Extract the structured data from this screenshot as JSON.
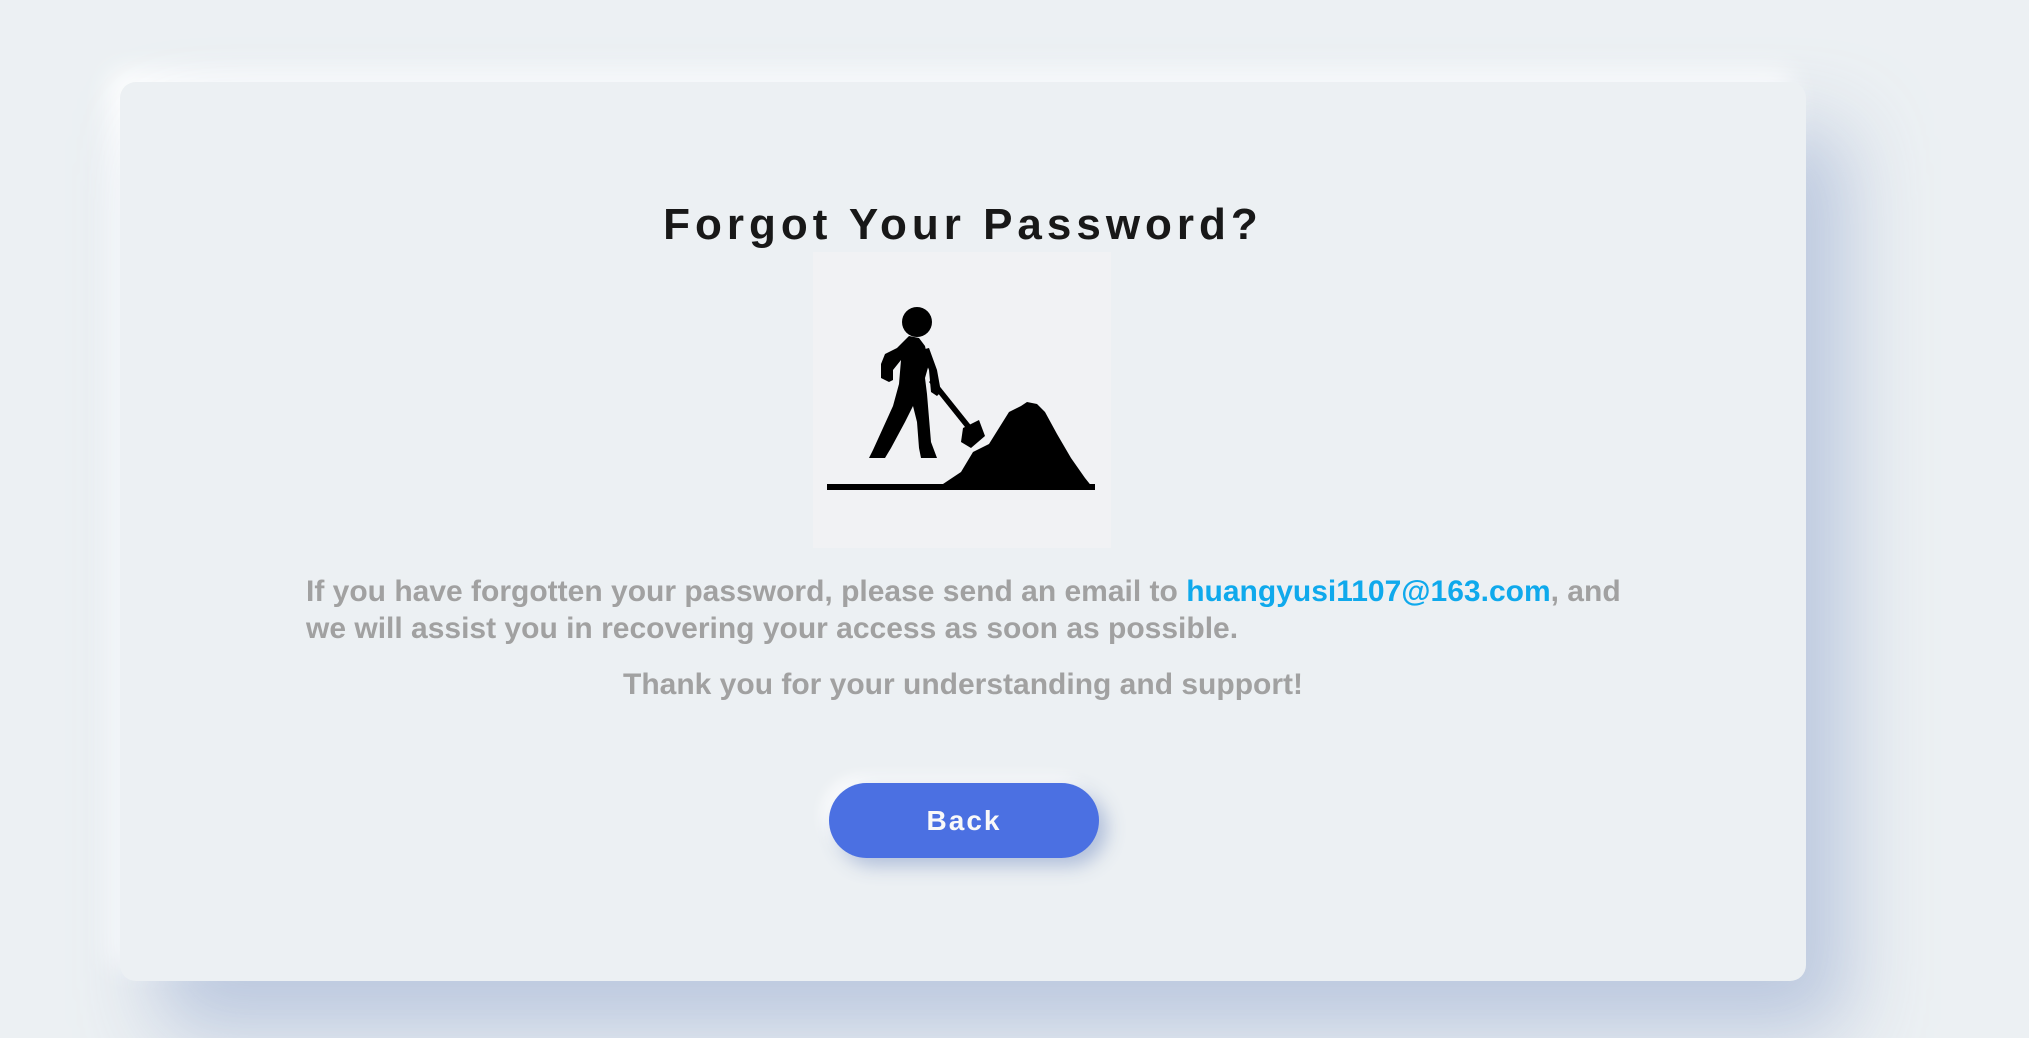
{
  "page": {
    "title": "Forgot Your Password?",
    "illustration_icon": "under-construction-worker-icon",
    "message": {
      "before_email": "If you have forgotten your password, please send an email to ",
      "email": "huangyusi1107@163.com",
      "after_email": ", and we will assist you in recovering your access as soon as possible."
    },
    "thanks": "Thank you for your understanding and support!",
    "back_button_label": "Back"
  },
  "colors": {
    "background": "#ecf0f3",
    "title": "#181818",
    "body_text": "#a1a1a1",
    "link": "#0fa9ec",
    "button": "#4b70e2",
    "button_text": "#f9f9f9"
  }
}
